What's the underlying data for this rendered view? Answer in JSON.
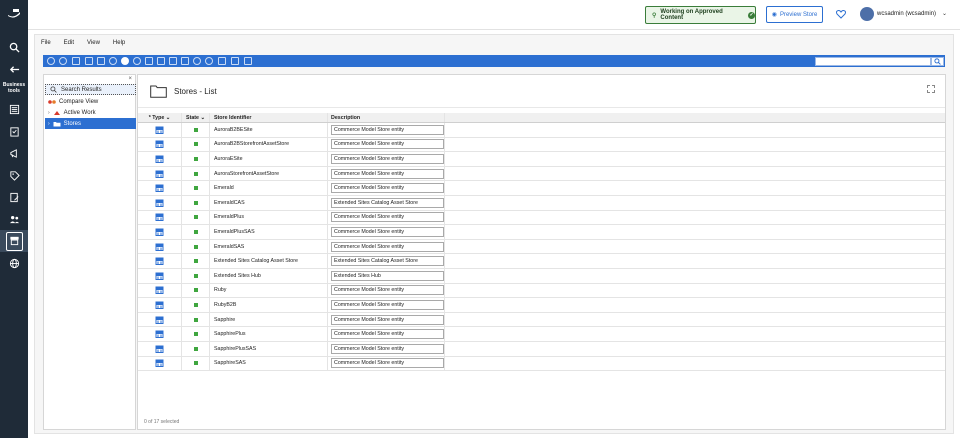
{
  "topbar": {
    "approved_label": "Working on Approved Content",
    "preview_label": "Preview Store",
    "user_name": "wcsadmin (wcsadmin)"
  },
  "rail": {
    "business_tools_label": "Business tools"
  },
  "menu": [
    "File",
    "Edit",
    "View",
    "Help"
  ],
  "nav": {
    "search_results": "Search Results",
    "compare_view": "Compare View",
    "active_work": "Active Work",
    "stores": "Stores"
  },
  "page": {
    "title": "Stores - List",
    "status": "0 of 17 selected"
  },
  "grid": {
    "headers": {
      "type": "* Type",
      "state": "State",
      "id": "Store Identifier",
      "desc": "Description"
    },
    "rows": [
      {
        "id": "AuroraB2BESite",
        "desc": "Commerce Model Store entity"
      },
      {
        "id": "AuroraB2BStorefrontAssetStore",
        "desc": "Commerce Model Store entity"
      },
      {
        "id": "AuroraESite",
        "desc": "Commerce Model Store entity"
      },
      {
        "id": "AuroraStorefrontAssetStore",
        "desc": "Commerce Model Store entity"
      },
      {
        "id": "Emerald",
        "desc": "Commerce Model Store entity"
      },
      {
        "id": "EmeraldCAS",
        "desc": "Extended Sites Catalog Asset Store"
      },
      {
        "id": "EmeraldPlus",
        "desc": "Commerce Model Store entity"
      },
      {
        "id": "EmeraldPlusSAS",
        "desc": "Commerce Model Store entity"
      },
      {
        "id": "EmeraldSAS",
        "desc": "Commerce Model Store entity"
      },
      {
        "id": "Extended Sites Catalog Asset Store",
        "desc": "Extended Sites Catalog Asset Store"
      },
      {
        "id": "Extended Sites Hub",
        "desc": "Extended Sites Hub"
      },
      {
        "id": "Ruby",
        "desc": "Commerce Model Store entity"
      },
      {
        "id": "RubyB2B",
        "desc": "Commerce Model Store entity"
      },
      {
        "id": "Sapphire",
        "desc": "Commerce Model Store entity"
      },
      {
        "id": "SapphirePlus",
        "desc": "Commerce Model Store entity"
      },
      {
        "id": "SapphirePlusSAS",
        "desc": "Commerce Model Store entity"
      },
      {
        "id": "SapphireSAS",
        "desc": "Commerce Model Store entity"
      }
    ]
  },
  "colors": {
    "accent": "#2c6fd1",
    "rail": "#1f2b38",
    "state_active": "#3fa63f"
  }
}
